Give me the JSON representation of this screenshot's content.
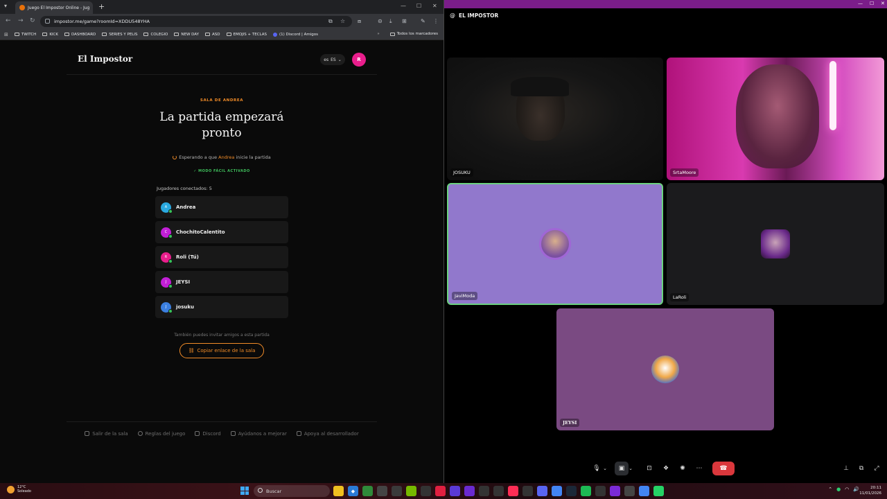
{
  "browser": {
    "tab_title": "Juego El Impostor Online - Jug",
    "url": "impostor.me/game?roomId=XDDU548YHA",
    "bookmarks": [
      "TWITCH",
      "KICK",
      "DASHBOARD",
      "SERIES Y PELIS",
      "COLEGIO",
      "NEW DAY",
      "ASD",
      "EMOJIS + TECLAS",
      "(1) Discord | Amigos"
    ],
    "all_bookmarks_label": "Todos los marcadores"
  },
  "site": {
    "logo": "El Impostor",
    "lang": "ES",
    "lang_flag": "es",
    "user_initial": "R",
    "room_label": "SALA DE ANDREA",
    "headline": "La partida empezará pronto",
    "waiting_prefix": "Esperando a que",
    "waiting_host": "Andrea",
    "waiting_suffix": "inicie la partida",
    "easy_mode": "MODO FÁCIL ACTIVADO",
    "players_label": "Jugadores conectados: 5",
    "players": [
      {
        "initial": "A",
        "name": "Andrea",
        "color": "#2aa9e0"
      },
      {
        "initial": "C",
        "name": "ChochitoCalentito",
        "color": "#c21fd6"
      },
      {
        "initial": "R",
        "name": "Roli (Tú)",
        "color": "#e91e8c"
      },
      {
        "initial": "J",
        "name": "JEYSI",
        "color": "#c21fd6"
      },
      {
        "initial": "J",
        "name": "josuku",
        "color": "#3b7fe0"
      }
    ],
    "invite_text": "También puedes invitar amigos a esta partida",
    "copy_button": "Copiar enlace de la sala",
    "footer": [
      "Salir de la sala",
      "Reglas del juego",
      "Discord",
      "Ayúdanos a mejorar",
      "Apoya al desarrollador"
    ]
  },
  "discord": {
    "channel": "EL IMPOSTOR",
    "participants": [
      {
        "name": "JOSUKU",
        "kind": "camera"
      },
      {
        "name": "SrtaMoore",
        "kind": "camera"
      },
      {
        "name": "JaviModa",
        "kind": "avatar",
        "bg": "#9178cc"
      },
      {
        "name": "LaRoli",
        "kind": "avatar",
        "bg": "#1b1b1d"
      },
      {
        "name": "JEYSI",
        "kind": "avatar",
        "bg": "#7a4a82"
      }
    ]
  },
  "taskbar": {
    "temp": "12°C",
    "weather": "Soleado",
    "search": "Buscar",
    "time": "20:11",
    "date": "11/01/2026"
  }
}
